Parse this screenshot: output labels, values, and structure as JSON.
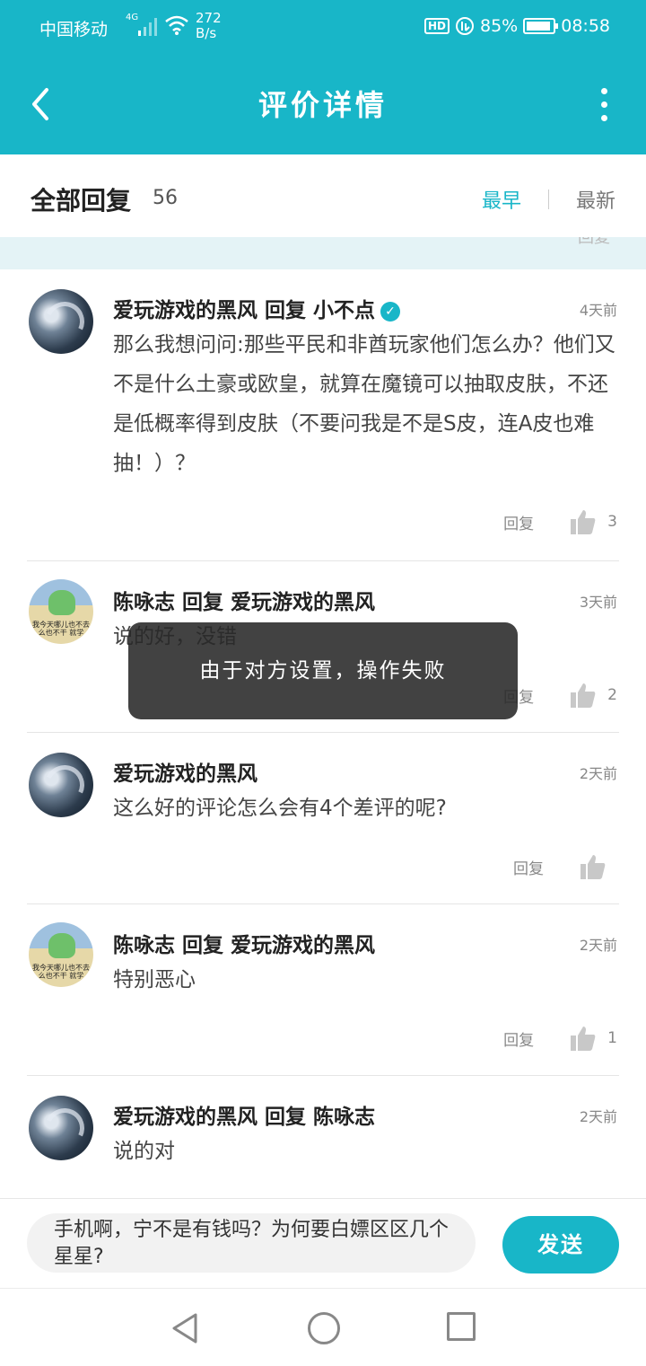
{
  "status_bar": {
    "carrier": "中国移动",
    "network": "4G",
    "speed_value": "272",
    "speed_unit": "B/s",
    "hd": "HD",
    "battery": "85%",
    "time": "08:58"
  },
  "appbar": {
    "title": "评价详情"
  },
  "replies_header": {
    "title": "全部回复",
    "count": "56",
    "sort_earliest": "最早",
    "sort_newest": "最新"
  },
  "reply_label": "回复",
  "comments": [
    {
      "author": "爱玩游戏的黑风",
      "reply_word": "回复",
      "target": "小不点",
      "time": "4天前",
      "text": "那么我想问问:那些平民和非酋玩家他们怎么办？他们又不是什么土豪或欧皇，就算在魔镜可以抽取皮肤，不还是低概率得到皮肤（不要问我是不是S皮，连A皮也难抽！）？",
      "likes": "3"
    },
    {
      "author": "陈咏志",
      "reply_word": "回复",
      "target": "爱玩游戏的黑风",
      "time": "3天前",
      "text": "说的好，没错",
      "likes": "2"
    },
    {
      "author": "爱玩游戏的黑风",
      "time": "2天前",
      "text": "这么好的评论怎么会有4个差评的呢?",
      "likes": ""
    },
    {
      "author": "陈咏志",
      "reply_word": "回复",
      "target": "爱玩游戏的黑风",
      "time": "2天前",
      "text": "特别恶心",
      "likes": "1"
    },
    {
      "author": "爱玩游戏的黑风",
      "reply_word": "回复",
      "target": "陈咏志",
      "time": "2天前",
      "text": "说的对",
      "likes": ""
    }
  ],
  "avatar_caption": "我今天哪儿也不去 么也不干 就学",
  "toast": "由于对方设置，操作失败",
  "input": {
    "value": "手机啊，宁不是有钱吗？为何要白嫖区区几个星星?",
    "send_label": "发送"
  }
}
